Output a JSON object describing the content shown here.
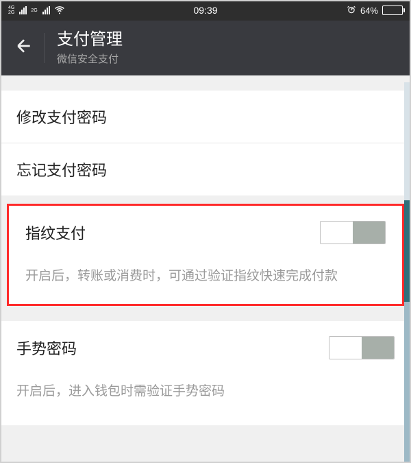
{
  "statusbar": {
    "signal1_label_top": "4G",
    "signal1_label_bot": "2G",
    "signal2_label_top": "2G",
    "time": "09:39",
    "battery_pct": "64%"
  },
  "header": {
    "title": "支付管理",
    "subtitle": "微信安全支付"
  },
  "rows": {
    "change_pwd": "修改支付密码",
    "forgot_pwd": "忘记支付密码"
  },
  "fingerprint": {
    "label": "指纹支付",
    "desc": "开启后，转账或消费时，可通过验证指纹快速完成付款"
  },
  "gesture": {
    "label": "手势密码",
    "desc": "开启后，进入钱包时需验证手势密码"
  }
}
